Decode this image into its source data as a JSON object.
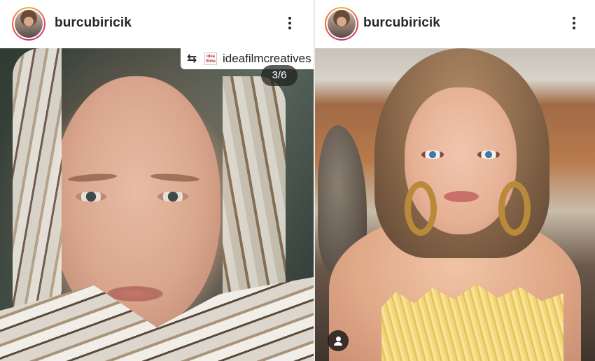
{
  "posts": [
    {
      "username": "burcubiricik",
      "repost": {
        "icon": "repost-icon",
        "user": "ideafilmcreatives",
        "logo_text": "idea films"
      },
      "counter": "3/6"
    },
    {
      "username": "burcubiricik",
      "tag_icon": "user-tag-icon"
    }
  ],
  "colors": {
    "text": "#262626",
    "background": "#ffffff",
    "counter_bg": "rgba(30,30,30,0.72)"
  }
}
